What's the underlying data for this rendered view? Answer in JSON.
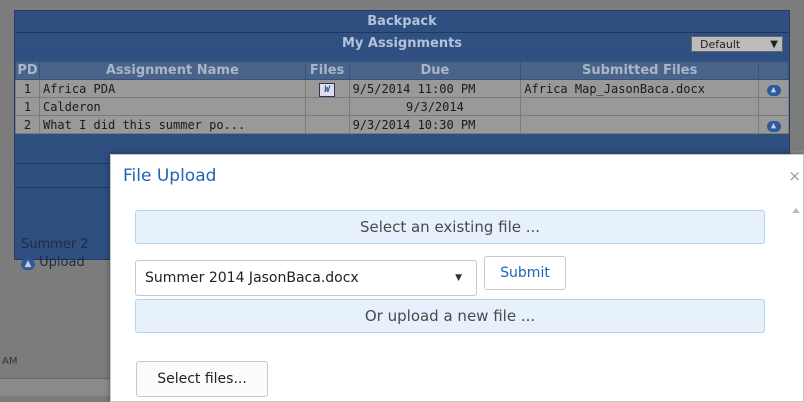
{
  "backpack": {
    "title": "Backpack",
    "subtitle": "My Assignments",
    "filter_select": "Default",
    "columns": [
      "PD",
      "Assignment Name",
      "Files",
      "Due",
      "Submitted Files"
    ],
    "rows": [
      {
        "pd": "1",
        "name": "Africa PDA",
        "due": "9/5/2014 11:00 PM",
        "submitted": "Africa Map_JasonBaca.docx"
      },
      {
        "pd": "1",
        "name": "Calderon",
        "due": "9/3/2014",
        "submitted": ""
      },
      {
        "pd": "2",
        "name": "What I did this summer po...",
        "due": "9/3/2014 10:30 PM",
        "submitted": ""
      }
    ],
    "summer_text": "Summer 2",
    "upload_link": "Upload",
    "am_text": "AM"
  },
  "modal": {
    "title": "File Upload",
    "close": "×",
    "existing_label": "Select an existing file ...",
    "selected_file": "Summer 2014 JasonBaca.docx",
    "submit_label": "Submit",
    "upload_label": "Or upload a new file ...",
    "select_files_label": "Select files..."
  },
  "colors": {
    "accent": "#1f64b5",
    "bar_bg": "#e6f1fb",
    "panel_bg": "#2e4f7f"
  }
}
